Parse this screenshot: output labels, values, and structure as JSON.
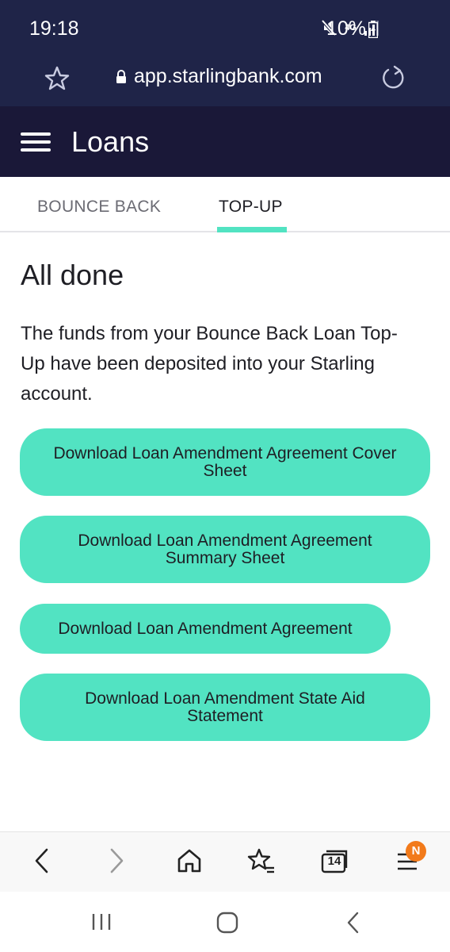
{
  "status_bar": {
    "time": "19:18",
    "network": "4G",
    "battery": "10%"
  },
  "url_bar": {
    "url": "app.starlingbank.com"
  },
  "header": {
    "title": "Loans"
  },
  "tabs": [
    {
      "label": "BOUNCE BACK"
    },
    {
      "label": "TOP-UP"
    }
  ],
  "main": {
    "heading": "All done",
    "body": "The funds from your Bounce Back Loan Top-Up have been deposited into your Starling account.",
    "buttons": [
      {
        "label": "Download Loan Amendment Agreement Cover Sheet"
      },
      {
        "label": "Download Loan Amendment Agreement Summary Sheet"
      },
      {
        "label": "Download Loan Amendment Agreement"
      },
      {
        "label": "Download Loan Amendment State Aid Statement"
      }
    ]
  },
  "browser_toolbar": {
    "tabs_count": "14",
    "menu_badge": "N"
  },
  "colors": {
    "status_bg": "#1f2448",
    "header_bg": "#1a1838",
    "accent": "#52e3c2",
    "badge": "#f27a1a"
  },
  "icons": [
    "star-icon",
    "lock-icon",
    "reload-icon",
    "menu-icon",
    "back-icon",
    "forward-icon",
    "home-icon",
    "bookmarks-icon",
    "tabs-icon",
    "browser-menu-icon",
    "recents-icon",
    "home-nav-icon",
    "back-nav-icon"
  ]
}
